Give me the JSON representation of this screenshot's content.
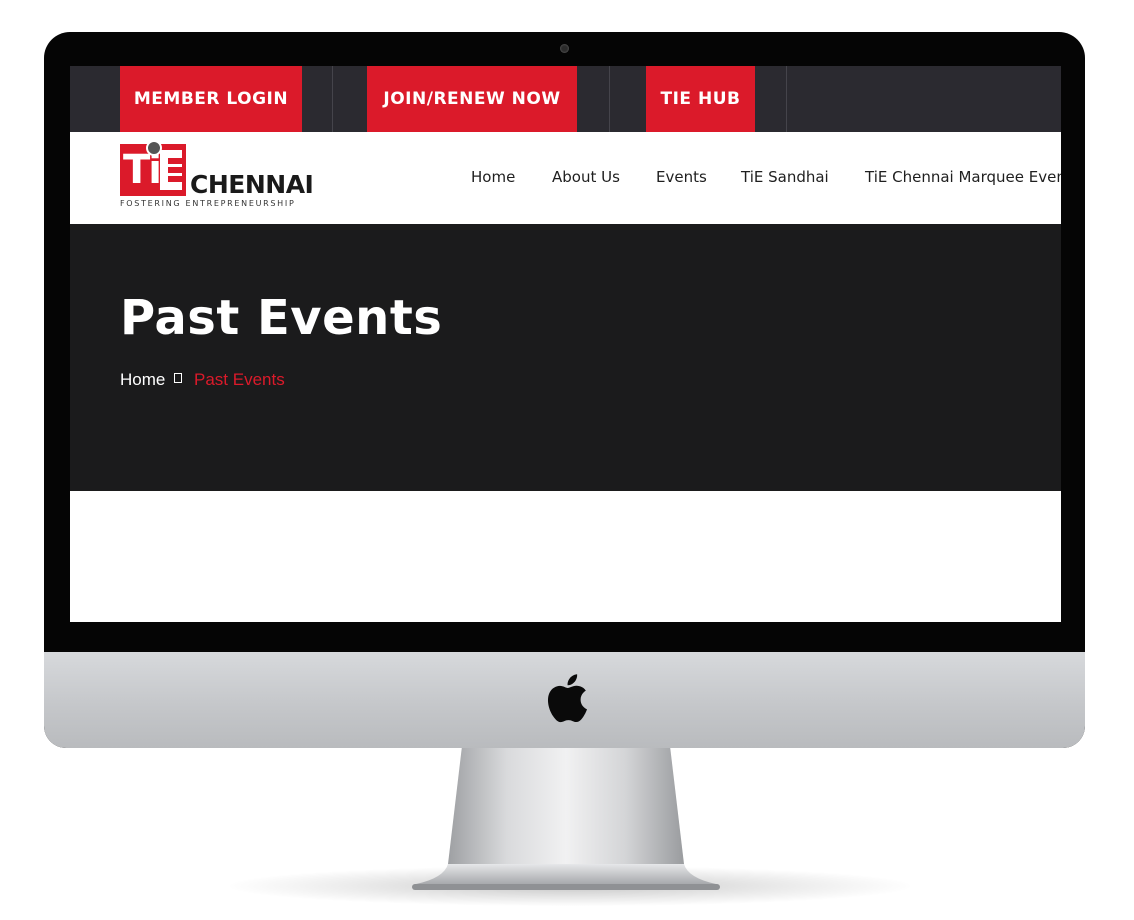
{
  "topbar": {
    "buttons": [
      {
        "label": "MEMBER LOGIN"
      },
      {
        "label": "JOIN/RENEW NOW"
      },
      {
        "label": "TIE HUB"
      }
    ]
  },
  "logo": {
    "ti": "Ti",
    "city": "CHENNAI",
    "tagline": "FOSTERING ENTREPRENEURSHIP"
  },
  "nav": {
    "items": [
      {
        "label": "Home"
      },
      {
        "label": "About Us"
      },
      {
        "label": "Events"
      },
      {
        "label": "TiE Sandhai"
      },
      {
        "label": "TiE Chennai Marquee Even"
      }
    ]
  },
  "hero": {
    "title": "Past Events",
    "breadcrumb": {
      "home": "Home",
      "current": "Past Events"
    }
  },
  "colors": {
    "accent": "#db1a2a",
    "topbar": "#2b2a30",
    "hero": "#1b1b1c",
    "bezel": "#050505"
  },
  "device": {
    "logo_icon": "apple-logo-icon",
    "camera_icon": "camera-icon"
  }
}
